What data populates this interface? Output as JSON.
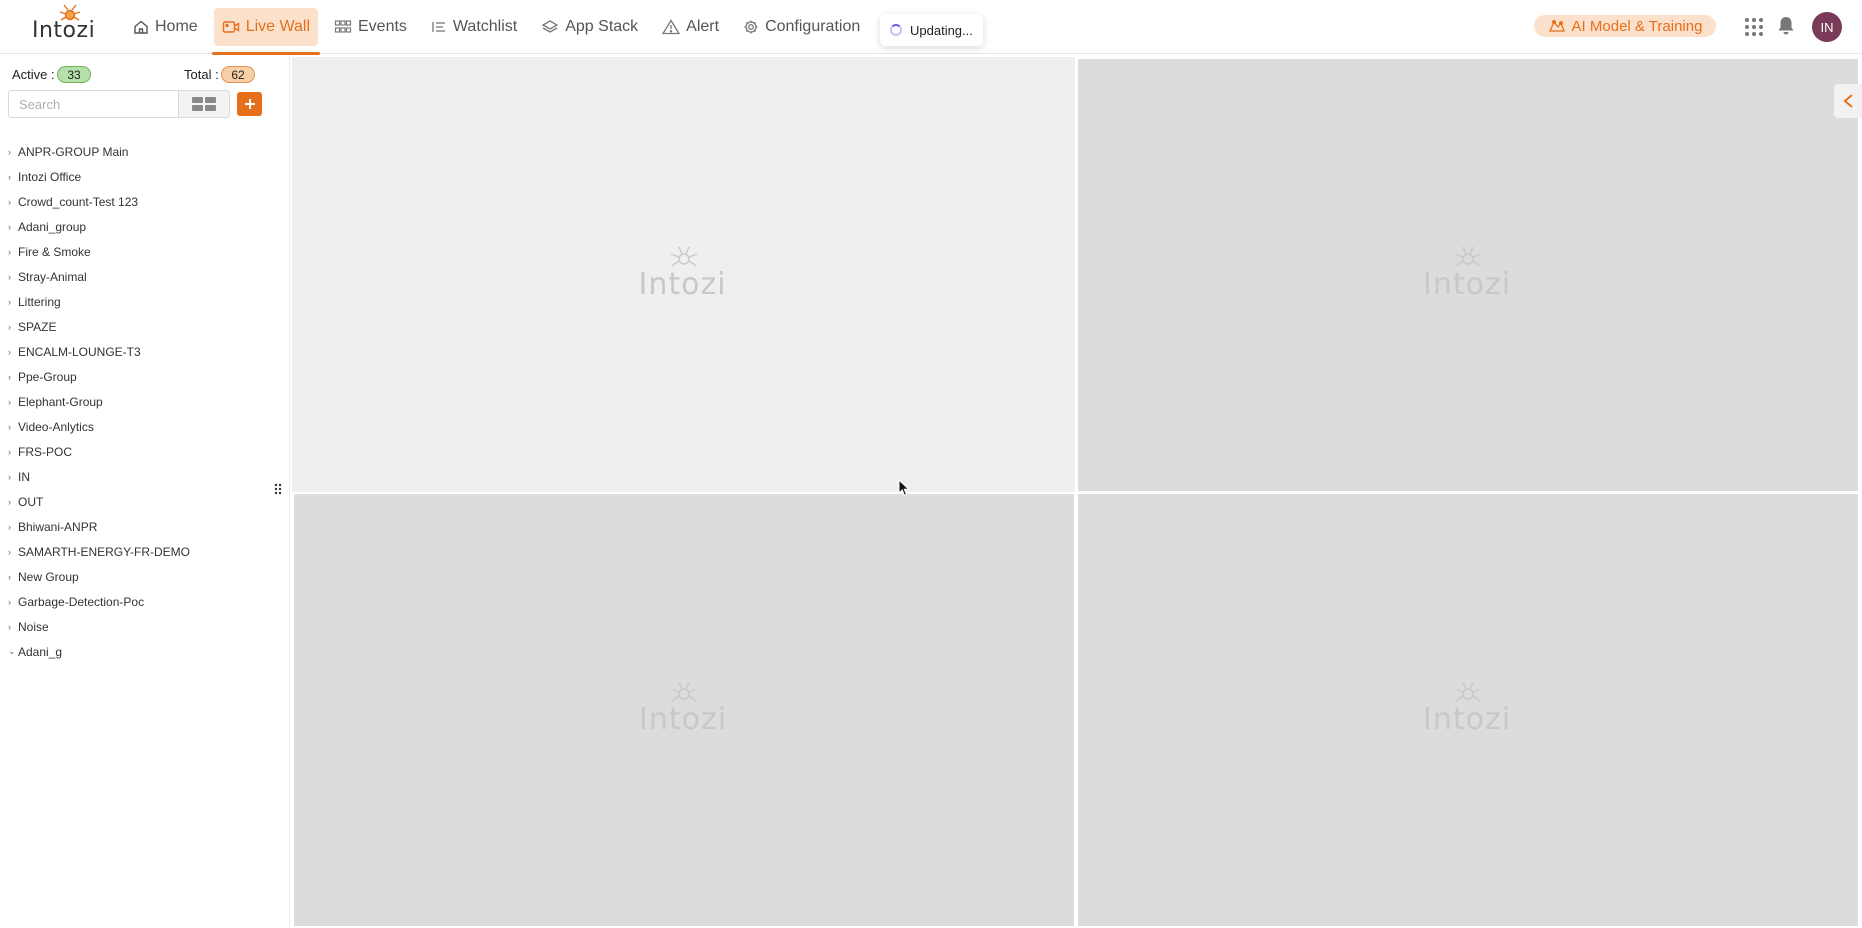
{
  "app": {
    "logo_text": "Intozi"
  },
  "nav": {
    "home": "Home",
    "live_wall": "Live Wall",
    "events": "Events",
    "watchlist": "Watchlist",
    "app_stack": "App Stack",
    "alert": "Alert",
    "configuration": "Configuration"
  },
  "status": {
    "toast": "Updating..."
  },
  "header": {
    "ai_button": "AI Model & Training",
    "avatar_initials": "IN"
  },
  "sidebar": {
    "active_label": "Active :",
    "active_count": "33",
    "total_label": "Total :",
    "total_count": "62",
    "search_placeholder": "Search",
    "groups": [
      "ANPR-GROUP Main",
      "Intozi Office",
      "Crowd_count-Test 123",
      "Adani_group",
      "Fire & Smoke",
      "Stray-Animal",
      "Littering",
      "SPAZE",
      "ENCALM-LOUNGE-T3",
      "Ppe-Group",
      "Elephant-Group",
      "Video-Anlytics",
      "FRS-POC",
      "IN",
      "OUT",
      "Bhiwani-ANPR",
      "SAMARTH-ENERGY-FR-DEMO",
      "New Group",
      "Garbage-Detection-Poc",
      "Noise",
      "Adani_g"
    ]
  },
  "grid": {
    "tile_logo_text": "Intozi"
  },
  "colors": {
    "accent": "#e56f1b",
    "accent_light": "#fbe1cc",
    "active_badge": "#b6e0a9",
    "total_badge": "#f8d0a8",
    "tile": "#dcdcdb"
  }
}
